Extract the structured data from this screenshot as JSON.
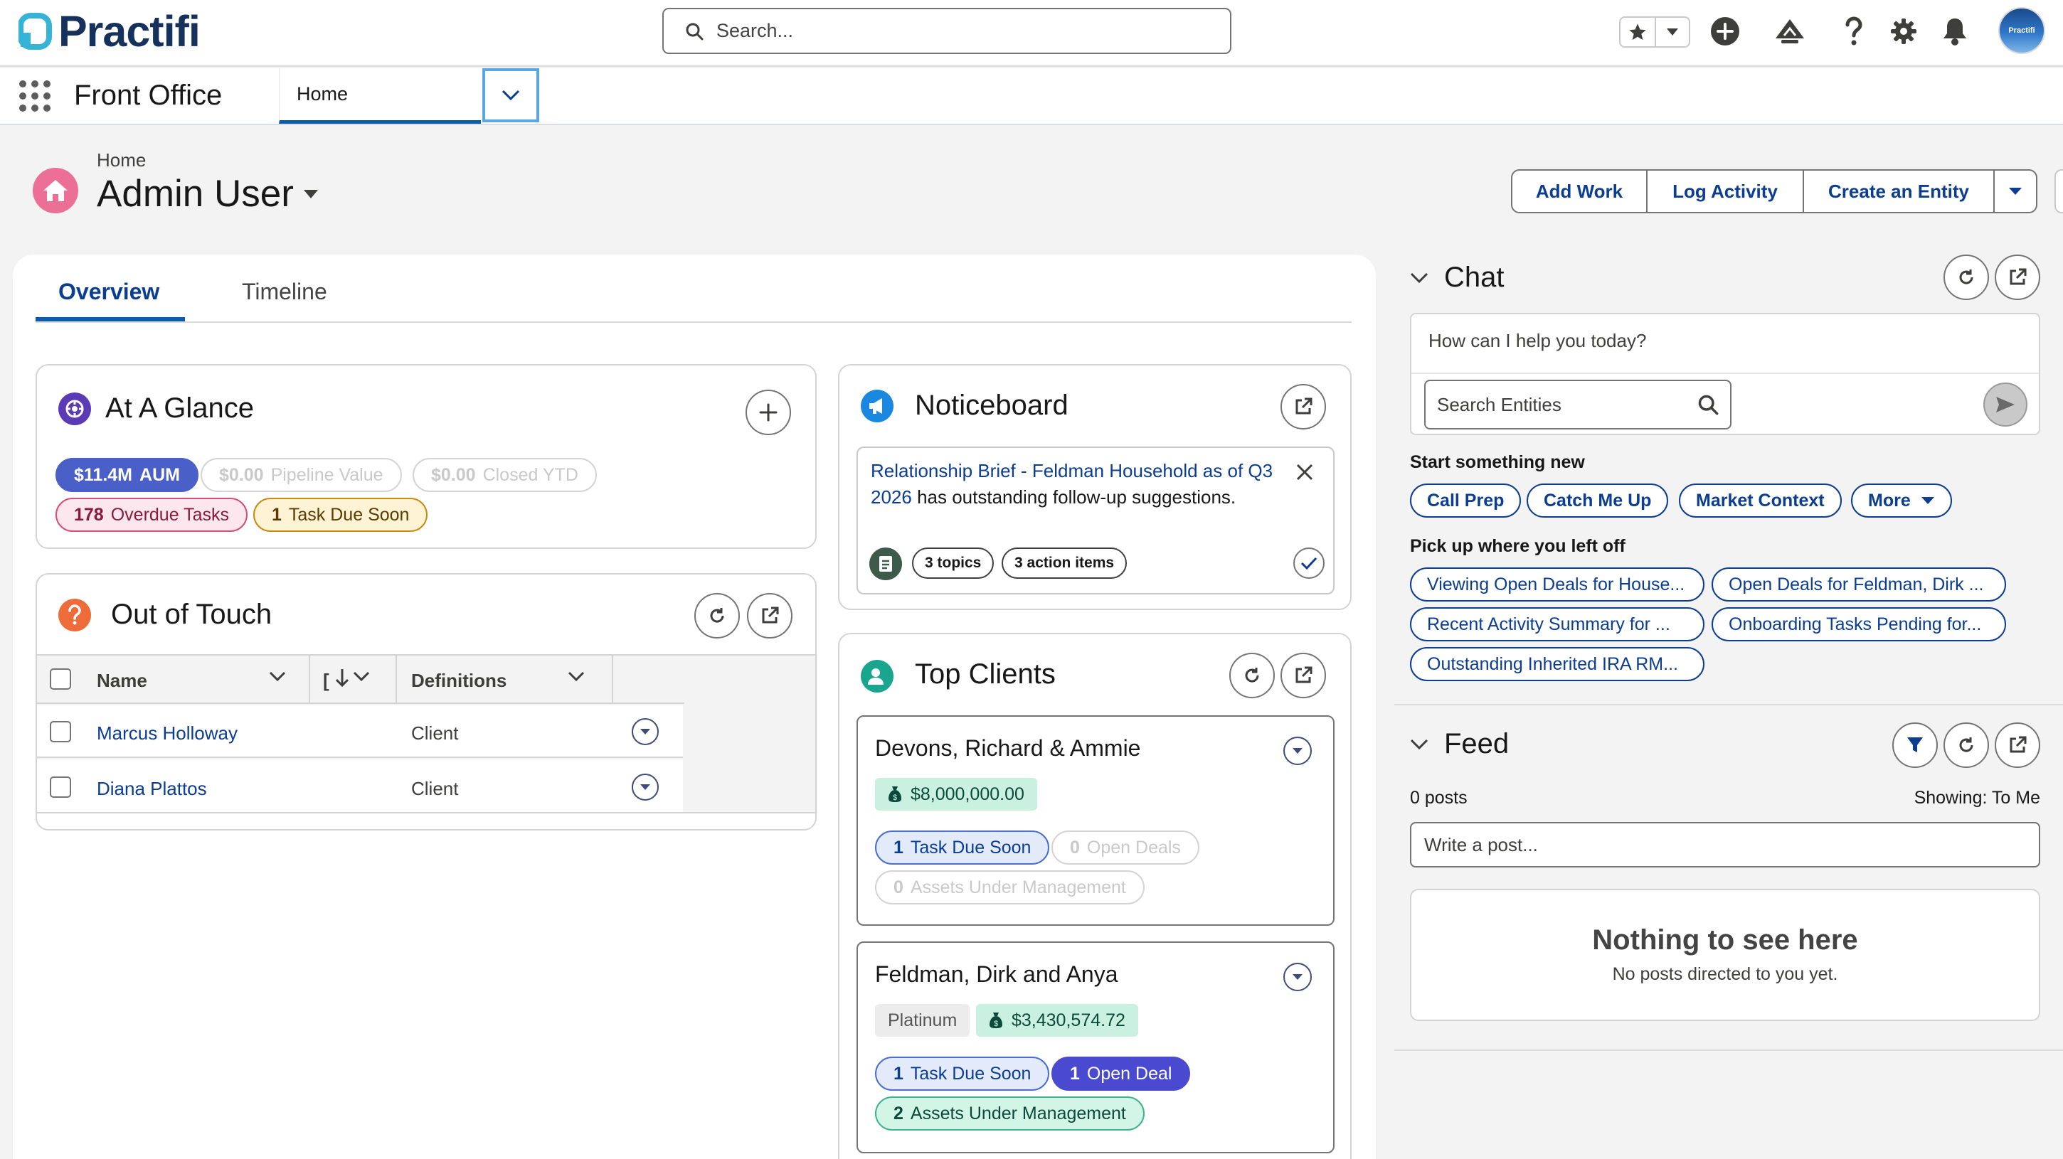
{
  "header": {
    "logo_text": "Practifi",
    "search_placeholder": "Search...",
    "avatar_text": "Practifi"
  },
  "nav": {
    "app_name": "Front Office",
    "active_tab": "Home"
  },
  "page": {
    "breadcrumb": "Home",
    "title": "Admin User",
    "actions": [
      "Add Work",
      "Log Activity",
      "Create an Entity"
    ]
  },
  "tabs": [
    "Overview",
    "Timeline"
  ],
  "at_a_glance": {
    "title": "At A Glance",
    "badges": [
      {
        "value": "$11.4M",
        "label": "AUM"
      },
      {
        "value": "$0.00",
        "label": "Pipeline Value"
      },
      {
        "value": "$0.00",
        "label": "Closed YTD"
      },
      {
        "value": "178",
        "label": "Overdue Tasks"
      },
      {
        "value": "1",
        "label": "Task Due Soon"
      }
    ]
  },
  "out_of_touch": {
    "title": "Out of Touch",
    "columns": [
      "Name",
      "[",
      "Definitions"
    ],
    "rows": [
      {
        "name": "Marcus Holloway",
        "definition": "Client"
      },
      {
        "name": "Diana Plattos",
        "definition": "Client"
      }
    ]
  },
  "noticeboard": {
    "title": "Noticeboard",
    "notice_link": "Relationship Brief - Feldman Household as of Q3 2026",
    "notice_text": "has outstanding follow-up suggestions.",
    "chips": [
      "3 topics",
      "3 action items"
    ]
  },
  "top_clients": {
    "title": "Top Clients",
    "clients": [
      {
        "name": "Devons, Richard & Ammie",
        "tier": "",
        "value": "$8,000,000.00",
        "pills": [
          {
            "value": "1",
            "label": "Task Due Soon"
          },
          {
            "value": "0",
            "label": "Open Deals"
          },
          {
            "value": "0",
            "label": "Assets Under Management"
          }
        ]
      },
      {
        "name": "Feldman, Dirk and Anya",
        "tier": "Platinum",
        "value": "$3,430,574.72",
        "pills": [
          {
            "value": "1",
            "label": "Task Due Soon"
          },
          {
            "value": "1",
            "label": "Open Deal"
          },
          {
            "value": "2",
            "label": "Assets Under Management"
          }
        ]
      }
    ]
  },
  "chat": {
    "title": "Chat",
    "prompt": "How can I help you today?",
    "entity_search_placeholder": "Search Entities",
    "start_label": "Start something new",
    "start_chips": [
      "Call Prep",
      "Catch Me Up",
      "Market Context",
      "More"
    ],
    "resume_label": "Pick up where you left off",
    "resume_chips": [
      "Viewing Open Deals for House...",
      "Open Deals for Feldman, Dirk ...",
      "Recent Activity Summary for ...",
      "Onboarding Tasks Pending for...",
      "Outstanding Inherited IRA RM..."
    ]
  },
  "feed": {
    "title": "Feed",
    "post_count": "0 posts",
    "showing": "Showing: To Me",
    "post_placeholder": "Write a post...",
    "empty_title": "Nothing to see here",
    "empty_text": "No posts directed to you yet."
  },
  "colors": {
    "brand_navy": "#16325c",
    "brand_teal": "#35b4d8",
    "link_blue": "#0b3d91",
    "home_pink": "#ec6f98",
    "aum_badge": "#4a5fc8"
  }
}
